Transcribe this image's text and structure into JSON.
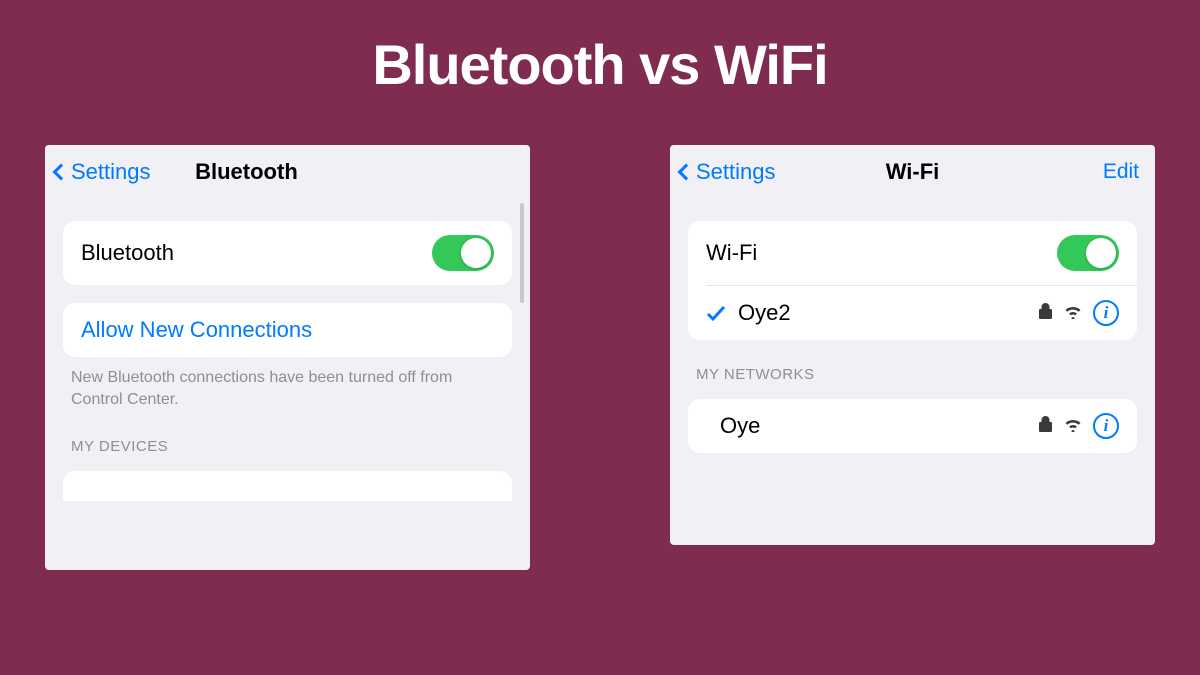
{
  "title": "Bluetooth vs WiFi",
  "colors": {
    "background": "#7f2c50",
    "accent": "#007aff",
    "toggleOn": "#34c759"
  },
  "bluetooth": {
    "back": "Settings",
    "title": "Bluetooth",
    "toggle": {
      "label": "Bluetooth",
      "on": true
    },
    "allowNew": "Allow New Connections",
    "helper": "New Bluetooth connections have been turned off from Control Center.",
    "sectionHeader": "MY DEVICES"
  },
  "wifi": {
    "back": "Settings",
    "title": "Wi-Fi",
    "edit": "Edit",
    "toggle": {
      "label": "Wi-Fi",
      "on": true
    },
    "connected": {
      "name": "Oye2",
      "secured": true
    },
    "sectionHeader": "MY NETWORKS",
    "networks": [
      {
        "name": "Oye",
        "secured": true
      }
    ]
  }
}
